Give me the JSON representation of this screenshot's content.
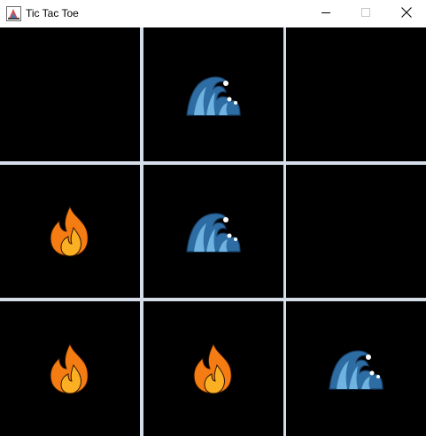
{
  "window": {
    "title": "Tic Tac Toe",
    "icon": "java-app-icon",
    "controls": [
      "minimize-icon",
      "maximize-icon",
      "close-icon"
    ]
  },
  "board": {
    "cells": [
      {
        "row": 1,
        "col": 1,
        "mark": ""
      },
      {
        "row": 1,
        "col": 2,
        "mark": "water"
      },
      {
        "row": 1,
        "col": 3,
        "mark": ""
      },
      {
        "row": 2,
        "col": 1,
        "mark": "fire"
      },
      {
        "row": 2,
        "col": 2,
        "mark": "water"
      },
      {
        "row": 2,
        "col": 3,
        "mark": ""
      },
      {
        "row": 3,
        "col": 1,
        "mark": "fire"
      },
      {
        "row": 3,
        "col": 2,
        "mark": "fire"
      },
      {
        "row": 3,
        "col": 3,
        "mark": "water"
      }
    ],
    "colors": {
      "background": "#000000",
      "grid_lines": "#d5dde8",
      "fire_outer": "#f47c12",
      "fire_inner": "#fbb024",
      "water_dark": "#2e6da4",
      "water_light": "#6fb3e0"
    }
  }
}
